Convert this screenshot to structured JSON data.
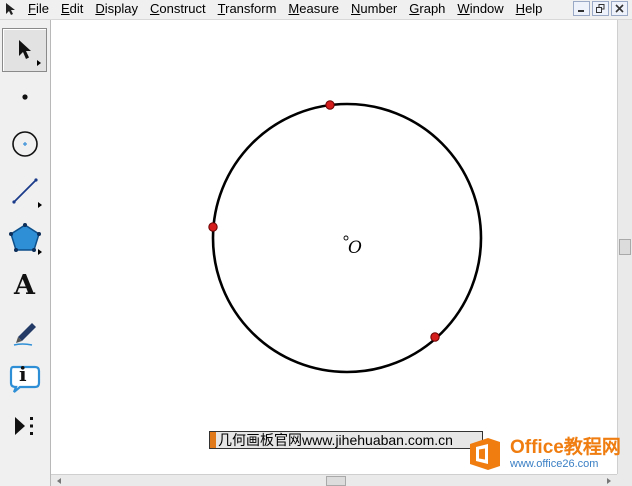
{
  "menu": {
    "items": [
      {
        "label": "File",
        "mnemonic": "F",
        "rest": "ile"
      },
      {
        "label": "Edit",
        "mnemonic": "E",
        "rest": "dit"
      },
      {
        "label": "Display",
        "mnemonic": "D",
        "rest": "isplay"
      },
      {
        "label": "Construct",
        "mnemonic": "C",
        "rest": "onstruct"
      },
      {
        "label": "Transform",
        "mnemonic": "T",
        "rest": "ransform"
      },
      {
        "label": "Measure",
        "mnemonic": "M",
        "rest": "easure"
      },
      {
        "label": "Number",
        "mnemonic": "N",
        "rest": "umber"
      },
      {
        "label": "Graph",
        "mnemonic": "G",
        "rest": "raph"
      },
      {
        "label": "Window",
        "mnemonic": "W",
        "rest": "indow"
      },
      {
        "label": "Help",
        "mnemonic": "H",
        "rest": "elp"
      }
    ]
  },
  "window_controls": [
    "minimize-icon",
    "restore-icon",
    "close-icon"
  ],
  "toolbox": {
    "tools": [
      {
        "name": "arrow-tool",
        "icon": "arrow-icon",
        "selected": true
      },
      {
        "name": "point-tool",
        "icon": "point-icon"
      },
      {
        "name": "compass-tool",
        "icon": "compass-icon"
      },
      {
        "name": "straightedge-tool",
        "icon": "straightedge-icon"
      },
      {
        "name": "polygon-tool",
        "icon": "polygon-icon"
      },
      {
        "name": "text-tool",
        "icon": "text-icon",
        "glyph": "A"
      },
      {
        "name": "marker-tool",
        "icon": "marker-icon"
      },
      {
        "name": "information-tool",
        "icon": "info-icon",
        "glyph": "i"
      },
      {
        "name": "custom-tool",
        "icon": "custom-tool-icon"
      }
    ]
  },
  "canvas": {
    "center_label": "O",
    "point_color": "#d41e1e",
    "circle_color": "#000000"
  },
  "watermark": {
    "banner_text": "几何画板官网www.jihehuaban.com.cn",
    "logo_title": "Office教程网",
    "logo_url": "www.office26.com",
    "logo_color": "#ef7d10"
  }
}
